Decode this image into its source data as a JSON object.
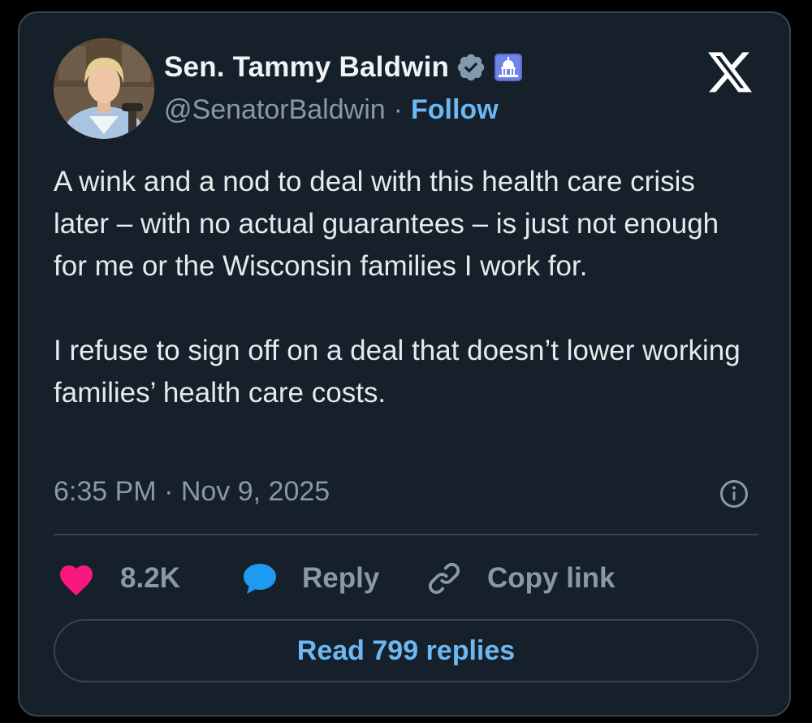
{
  "author": {
    "display_name": "Sen. Tammy Baldwin",
    "handle": "@SenatorBaldwin",
    "separator": "·",
    "follow_label": "Follow"
  },
  "tweet": {
    "paragraphs": [
      "A wink and a nod to deal with this health care crisis later – with no actual guarantees – is just not enough for me or the Wisconsin families I work for.",
      "I refuse to sign off on a deal that doesn’t lower working families’ health care costs."
    ],
    "timestamp": "6:35 PM · Nov 9, 2025"
  },
  "actions": {
    "like_count": "8.2K",
    "reply_label": "Reply",
    "copy_link_label": "Copy link"
  },
  "read_replies_label": "Read 799 replies",
  "icons": {
    "verified": "verified-badge-icon",
    "affiliate": "capitol-building-icon",
    "brand": "x-logo-icon",
    "info": "info-icon",
    "like": "heart-icon",
    "reply": "speech-bubble-icon",
    "copy_link": "link-icon"
  },
  "colors": {
    "background": "#15202b",
    "border": "#38444d",
    "text": "#e7e9ea",
    "muted": "#8b98a5",
    "accent": "#6cb8f2",
    "like": "#f91880",
    "reply": "#1d9bf0"
  }
}
